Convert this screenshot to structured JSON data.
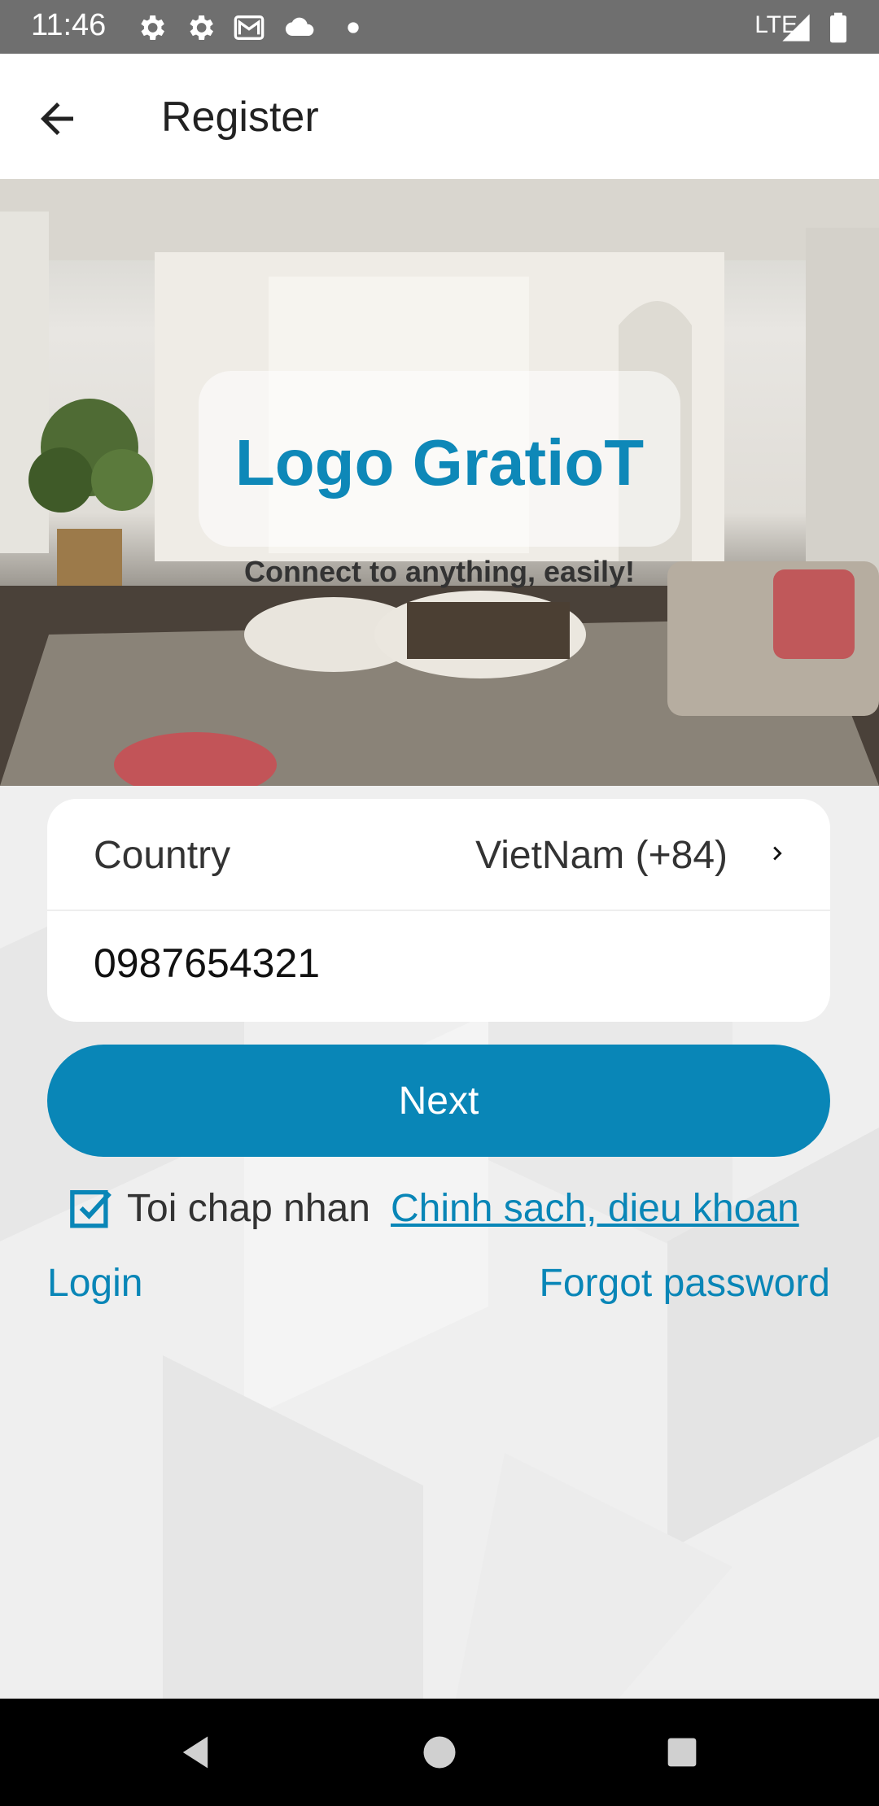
{
  "status_bar": {
    "time": "11:46",
    "network": "LTE",
    "icons": [
      "settings-icon",
      "settings-icon",
      "gmail-icon",
      "cloud-icon",
      "dot-icon",
      "signal-icon",
      "battery-icon"
    ]
  },
  "app_bar": {
    "title": "Register",
    "back_icon": "arrow-back-icon"
  },
  "hero": {
    "logo_text": "Logo GratioT",
    "tagline": "Connect to anything, easily!"
  },
  "form": {
    "country_label": "Country",
    "country_value": "VietNam (+84)",
    "phone_value": "0987654321"
  },
  "buttons": {
    "next_label": "Next"
  },
  "terms": {
    "checked": true,
    "text": "Toi chap nhan",
    "link": "Chinh sach, dieu khoan"
  },
  "links": {
    "login": "Login",
    "forgot_password": "Forgot password"
  },
  "colors": {
    "accent": "#0986b7",
    "status_bar": "#6f6f6f",
    "background": "#efefef"
  }
}
